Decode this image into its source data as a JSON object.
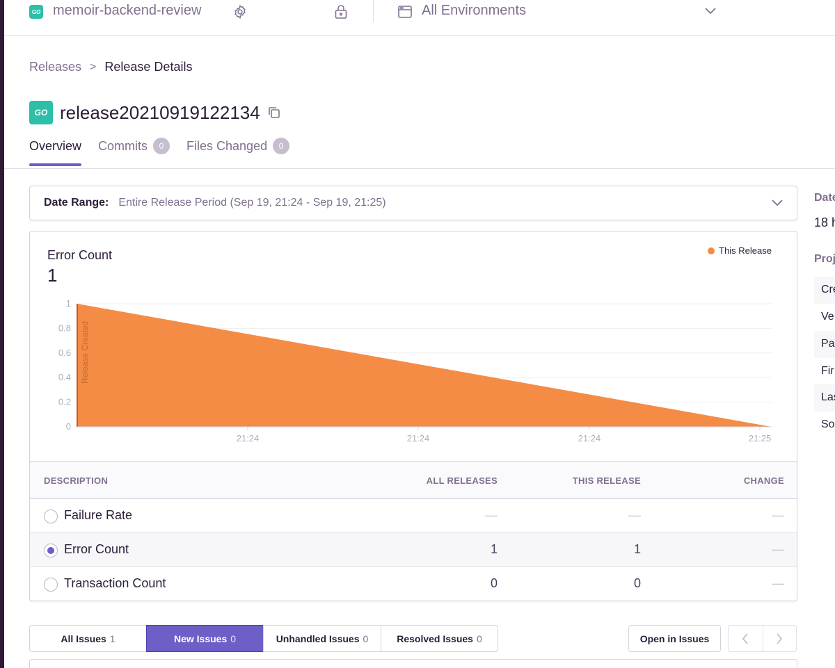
{
  "topbar": {
    "project_logo_text": "GO",
    "project_name": "memoir-backend-review",
    "environment": "All Environments"
  },
  "breadcrumb": {
    "parent": "Releases",
    "separator": ">",
    "current": "Release Details"
  },
  "release": {
    "logo_text": "GO",
    "name": "release20210919122134"
  },
  "tabs": [
    {
      "label": "Overview",
      "active": true
    },
    {
      "label": "Commits",
      "badge": "0"
    },
    {
      "label": "Files Changed",
      "badge": "0"
    }
  ],
  "date_range": {
    "label": "Date Range:",
    "value": "Entire Release Period (Sep 19, 21:24 - Sep 19, 21:25)"
  },
  "chart": {
    "title": "Error Count",
    "total": "1",
    "legend": "This Release",
    "marker_label": "Release Created",
    "color": "#f58c46"
  },
  "chart_data": {
    "type": "area",
    "x_ticks": [
      "21:24",
      "21:24",
      "21:24",
      "21:25"
    ],
    "y_ticks": [
      "0",
      "0.2",
      "0.4",
      "0.6",
      "0.8",
      "1"
    ],
    "ylim": [
      0,
      1
    ],
    "series": [
      {
        "name": "This Release",
        "values": [
          1,
          0
        ]
      }
    ]
  },
  "table": {
    "headers": {
      "description": "DESCRIPTION",
      "all": "ALL RELEASES",
      "this": "THIS RELEASE",
      "change": "CHANGE"
    },
    "rows": [
      {
        "label": "Failure Rate",
        "all": "—",
        "this": "—",
        "change": "—",
        "selected": false
      },
      {
        "label": "Error Count",
        "all": "1",
        "this": "1",
        "change": "—",
        "selected": true
      },
      {
        "label": "Transaction Count",
        "all": "0",
        "this": "0",
        "change": "—",
        "selected": false
      }
    ]
  },
  "issues": {
    "filters": [
      {
        "label": "All Issues",
        "count": "1",
        "active": false
      },
      {
        "label": "New Issues",
        "count": "0",
        "active": true
      },
      {
        "label": "Unhandled Issues",
        "count": "0",
        "active": false
      },
      {
        "label": "Resolved Issues",
        "count": "0",
        "active": false
      }
    ],
    "open_button": "Open in Issues",
    "prev": "‹",
    "next": "›"
  },
  "sidebar": {
    "date_label": "Date",
    "date_value": "18 h",
    "projects_label": "Proj",
    "rows": [
      "Cre",
      "Ve",
      "Pa",
      "Fir",
      "Las",
      "So"
    ]
  }
}
